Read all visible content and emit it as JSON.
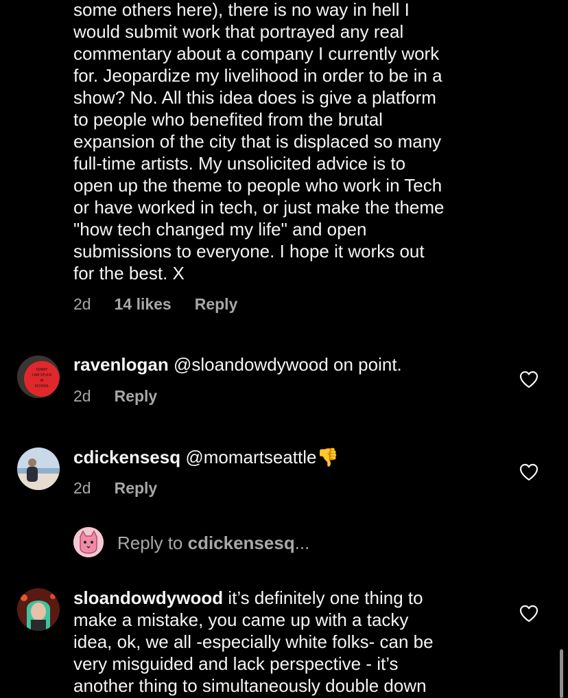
{
  "top_comment": {
    "body": "some others here), there is no way in hell I\nwould submit work that portrayed any real\ncommentary about a company I currently work\nfor. Jeopardize my livelihood in order to be in a\nshow? No. All this idea does is give a platform\nto people who benefited from the brutal\nexpansion of the city that is displaced so many\nfull-time artists. My unsolicited advice is to\nopen up the theme to people who work in Tech\nor have worked in tech, or just make the theme\n\"how tech changed my life\" and open\nsubmissions to everyone. I hope it works out\nfor the best. X",
    "time": "2d",
    "likes": "14 likes",
    "reply": "Reply"
  },
  "comments": [
    {
      "username": "ravenlogan",
      "text": " @sloandowdywood on point.",
      "time": "2d",
      "reply": "Reply",
      "avatar_text": "SORRY I AM STUCK IN SCHOOL"
    },
    {
      "username": "cdickensesq",
      "text": " @momartseattle",
      "emoji": "👎",
      "time": "2d",
      "reply": "Reply"
    },
    {
      "username": "sloandowdywood",
      "text_lines": [
        " it’s definitely one thing to",
        "make a mistake, you came up with a tacky",
        "idea, ok, we all -especially white folks- can be",
        "very misguided and lack perspective - it’s",
        "another thing to simultaneously double down"
      ]
    }
  ],
  "reply_to": {
    "prefix": "Reply to ",
    "username": "cdickensesq",
    "suffix": "..."
  },
  "colors": {
    "background": "#000000",
    "text": "#f5f5f5",
    "muted": "#a8a8a8"
  }
}
